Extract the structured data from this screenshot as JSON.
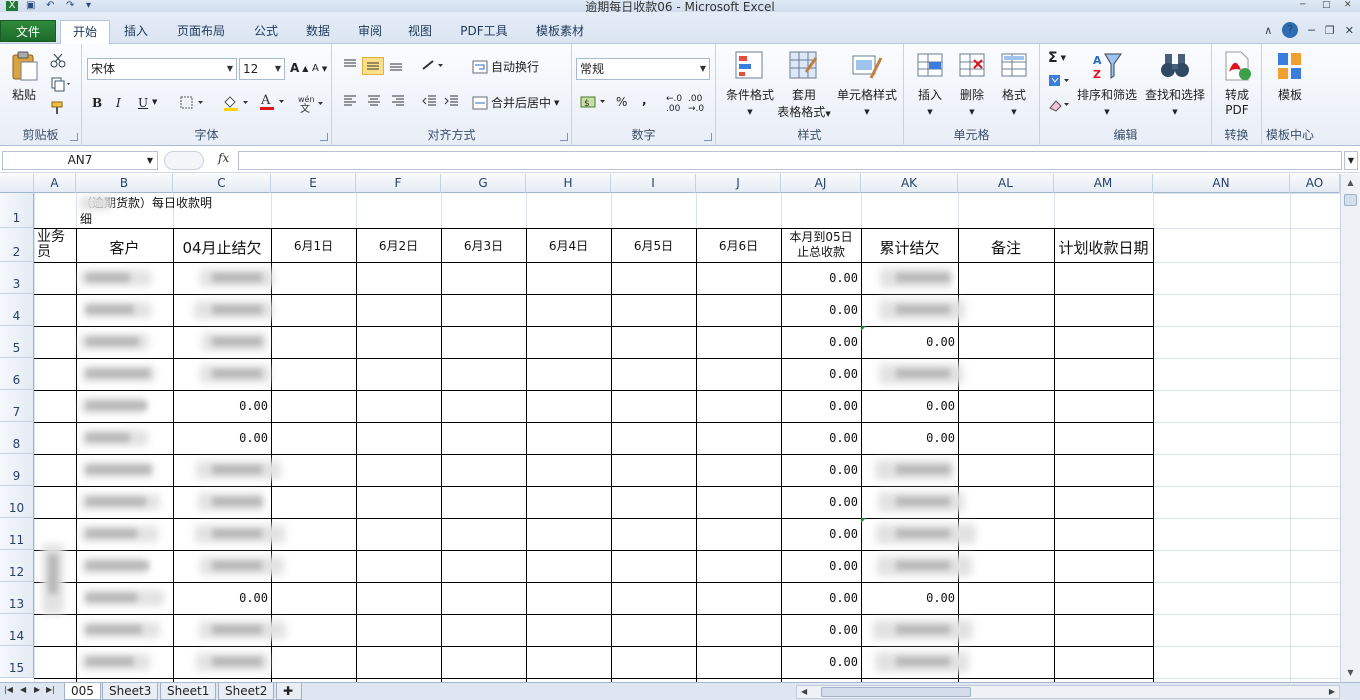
{
  "window": {
    "title": "逾期每日收款06 - Microsoft Excel"
  },
  "ribbon": {
    "tabs": [
      "文件",
      "开始",
      "插入",
      "页面布局",
      "公式",
      "数据",
      "审阅",
      "视图",
      "PDF工具",
      "模板素材"
    ],
    "active_tab": "开始",
    "groups": {
      "clipboard": {
        "label": "剪贴板",
        "paste": "粘贴"
      },
      "font": {
        "label": "字体",
        "font_name": "宋体",
        "font_size": "12",
        "bold": "B",
        "italic": "I",
        "underline": "U"
      },
      "alignment": {
        "label": "对齐方式",
        "wrap": "自动换行",
        "merge": "合并后居中"
      },
      "number": {
        "label": "数字",
        "format": "常规",
        "percent": "%",
        "comma": ","
      },
      "styles": {
        "label": "样式",
        "conditional": "条件格式",
        "table_format_1": "套用",
        "table_format_2": "表格格式",
        "cell_styles": "单元格样式"
      },
      "cells": {
        "label": "单元格",
        "insert": "插入",
        "delete": "删除",
        "format": "格式"
      },
      "editing": {
        "label": "编辑",
        "sort_filter": "排序和筛选",
        "find_select": "查找和选择"
      },
      "convert": {
        "label": "转换",
        "to_pdf_1": "转成",
        "to_pdf_2": "PDF"
      },
      "template": {
        "label": "模板中心",
        "btn": "模板"
      }
    }
  },
  "formula_bar": {
    "name_box": "AN7",
    "fx": "fx",
    "value": ""
  },
  "columns": [
    "A",
    "B",
    "C",
    "E",
    "F",
    "G",
    "H",
    "I",
    "J",
    "AJ",
    "AK",
    "AL",
    "AM",
    "AN",
    "AO"
  ],
  "rows": [
    "1",
    "2",
    "3",
    "4",
    "5",
    "6",
    "7",
    "8",
    "9",
    "10",
    "11",
    "12",
    "13",
    "14",
    "15"
  ],
  "sheet": {
    "title_line1": "（逾期货款）每日收款明",
    "title_line2": "细",
    "headers": {
      "salesperson_1": "业务",
      "salesperson_2": "员",
      "customer": "客户",
      "april_balance": "04月止结欠",
      "d1": "6月1日",
      "d2": "6月2日",
      "d3": "6月3日",
      "d4": "6月4日",
      "d5": "6月5日",
      "d6": "6月6日",
      "total_1": "本月到05日",
      "total_2": "止总收款",
      "cumulative": "累计结欠",
      "remark": "备注",
      "plan_date": "计划收款日期"
    },
    "april_balance_visible": {
      "7": "0.00",
      "8": "0.00",
      "13": "0.00"
    },
    "total_received": [
      "0.00",
      "0.00",
      "0.00",
      "0.00",
      "0.00",
      "0.00",
      "0.00",
      "0.00",
      "0.00",
      "0.00",
      "0.00",
      "0.00",
      "0.00"
    ],
    "cumulative_visible": {
      "5": "0.00",
      "7": "0.00",
      "8": "0.00",
      "13": "0.00"
    }
  },
  "sheet_tabs": [
    "005",
    "Sheet3",
    "Sheet1",
    "Sheet2"
  ],
  "active_sheet": "005"
}
